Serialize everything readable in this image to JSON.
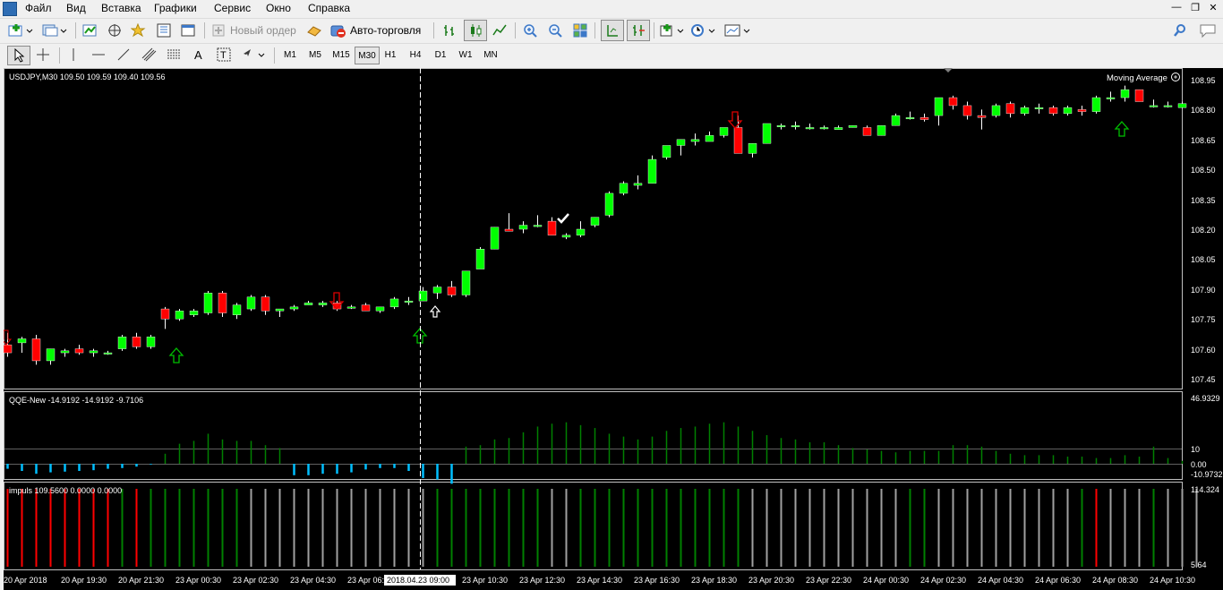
{
  "menu": [
    "Файл",
    "Вид",
    "Вставка",
    "Графики",
    "Сервис",
    "Окно",
    "Справка"
  ],
  "toolbar": {
    "new_order": "Новый ордер",
    "auto_trading": "Авто-торговля"
  },
  "timeframes": [
    "M1",
    "M5",
    "M15",
    "M30",
    "H1",
    "H4",
    "D1",
    "W1",
    "MN"
  ],
  "active_timeframe": "M30",
  "chart": {
    "symbol_info": "USDJPY,M30  109.50 109.59 109.40 109.56",
    "indicator_label": "Moving Average",
    "price_axis": [
      "108.95",
      "108.80",
      "108.65",
      "108.50",
      "108.35",
      "108.20",
      "108.05",
      "107.90",
      "107.75",
      "107.60",
      "107.45"
    ],
    "crosshair_time": "2018.04.23 09:00",
    "time_axis": [
      "20 Apr 2018",
      "20 Apr 19:30",
      "20 Apr 21:30",
      "23 Apr 00:30",
      "23 Apr 02:30",
      "23 Apr 04:30",
      "23 Apr 06:30",
      "23 Apr 08:30",
      "23 Apr 10:30",
      "23 Apr 12:30",
      "23 Apr 14:30",
      "23 Apr 16:30",
      "23 Apr 18:30",
      "23 Apr 20:30",
      "23 Apr 22:30",
      "24 Apr 00:30",
      "24 Apr 02:30",
      "24 Apr 04:30",
      "24 Apr 06:30",
      "24 Apr 08:30",
      "24 Apr 10:30"
    ]
  },
  "qqe": {
    "label": "QQE-New -14.9192 -14.9192 -9.7106",
    "axis": [
      "46.9329",
      "10",
      "0.00",
      "-10.9732"
    ]
  },
  "impuls": {
    "label": "impuls 109.5600 0.0000 0.0000",
    "axis": [
      "114.324",
      "5.64"
    ]
  },
  "colors": {
    "bull": "#00ff00",
    "bear": "#ff0000",
    "qqe_pos": "#008000",
    "qqe_neg": "#00bfff",
    "imp_red": "#ff0000",
    "imp_green": "#008000",
    "imp_gray": "#a0a0a0"
  },
  "chart_data": {
    "type": "candlestick",
    "candles": [
      [
        "O",
        107.62,
        107.68,
        107.56,
        107.58
      ],
      [
        null,
        107.63,
        107.66,
        107.58,
        107.65
      ],
      [
        null,
        107.65,
        107.67,
        107.52,
        107.54
      ],
      [
        null,
        107.54,
        107.6,
        107.52,
        107.6
      ],
      [
        null,
        107.58,
        107.6,
        107.56,
        107.59
      ],
      [
        null,
        107.6,
        107.62,
        107.57,
        107.58
      ],
      [
        null,
        107.58,
        107.6,
        107.56,
        107.59
      ],
      [
        null,
        107.58,
        107.59,
        107.57,
        107.58
      ],
      [
        null,
        107.6,
        107.67,
        107.59,
        107.66
      ],
      [
        null,
        107.66,
        107.68,
        107.6,
        107.61
      ],
      [
        null,
        107.61,
        107.67,
        107.6,
        107.66
      ],
      [
        null,
        107.8,
        107.81,
        107.7,
        107.75
      ],
      [
        null,
        107.75,
        107.8,
        107.74,
        107.79
      ],
      [
        null,
        107.77,
        107.8,
        107.76,
        107.79
      ],
      [
        null,
        107.78,
        107.89,
        107.77,
        107.88
      ],
      [
        null,
        107.88,
        107.89,
        107.76,
        107.78
      ],
      [
        null,
        107.77,
        107.83,
        107.75,
        107.82
      ],
      [
        null,
        107.8,
        107.87,
        107.79,
        107.86
      ],
      [
        null,
        107.86,
        107.87,
        107.77,
        107.79
      ],
      [
        null,
        107.79,
        107.8,
        107.76,
        107.8
      ],
      [
        null,
        107.8,
        107.82,
        107.79,
        107.81
      ],
      [
        null,
        107.82,
        107.84,
        107.82,
        107.83
      ],
      [
        null,
        107.82,
        107.84,
        107.81,
        107.83
      ],
      [
        null,
        107.83,
        107.84,
        107.79,
        107.8
      ],
      [
        null,
        107.81,
        107.82,
        107.8,
        107.81
      ],
      [
        null,
        107.82,
        107.83,
        107.79,
        107.79
      ],
      [
        null,
        107.79,
        107.81,
        107.78,
        107.81
      ],
      [
        null,
        107.81,
        107.86,
        107.8,
        107.85
      ],
      [
        null,
        107.84,
        107.86,
        107.82,
        107.84
      ],
      [
        null,
        107.84,
        107.91,
        107.84,
        107.89
      ],
      [
        null,
        107.88,
        107.92,
        107.85,
        107.91
      ],
      [
        null,
        107.91,
        107.94,
        107.86,
        107.87
      ],
      [
        null,
        107.87,
        107.99,
        107.86,
        107.99
      ],
      [
        null,
        108.0,
        108.11,
        108.0,
        108.1
      ],
      [
        null,
        108.1,
        108.21,
        108.1,
        108.21
      ],
      [
        null,
        108.2,
        108.28,
        108.19,
        108.19
      ],
      [
        null,
        108.2,
        108.24,
        108.18,
        108.22
      ],
      [
        null,
        108.22,
        108.27,
        108.21,
        108.22
      ],
      [
        null,
        108.24,
        108.26,
        108.17,
        108.17
      ],
      [
        null,
        108.16,
        108.18,
        108.15,
        108.17
      ],
      [
        null,
        108.17,
        108.24,
        108.16,
        108.2
      ],
      [
        null,
        108.22,
        108.26,
        108.21,
        108.26
      ],
      [
        null,
        108.27,
        108.39,
        108.26,
        108.38
      ],
      [
        null,
        108.38,
        108.44,
        108.37,
        108.43
      ],
      [
        null,
        108.42,
        108.47,
        108.4,
        108.43
      ],
      [
        null,
        108.43,
        108.57,
        108.43,
        108.55
      ],
      [
        null,
        108.56,
        108.62,
        108.55,
        108.62
      ],
      [
        null,
        108.62,
        108.65,
        108.57,
        108.65
      ],
      [
        null,
        108.64,
        108.68,
        108.62,
        108.65
      ],
      [
        null,
        108.64,
        108.69,
        108.64,
        108.67
      ],
      [
        null,
        108.67,
        108.7,
        108.66,
        108.71
      ],
      [
        null,
        108.71,
        108.77,
        108.61,
        108.58
      ],
      [
        null,
        108.58,
        108.63,
        108.56,
        108.63
      ],
      [
        null,
        108.63,
        108.73,
        108.63,
        108.73
      ],
      [
        null,
        108.72,
        108.73,
        108.7,
        108.72
      ],
      [
        null,
        108.72,
        108.74,
        108.7,
        108.72
      ],
      [
        null,
        108.71,
        108.73,
        108.7,
        108.71
      ],
      [
        null,
        108.71,
        108.72,
        108.7,
        108.71
      ],
      [
        null,
        108.7,
        108.72,
        108.7,
        108.71
      ],
      [
        null,
        108.71,
        108.72,
        108.71,
        108.72
      ],
      [
        null,
        108.71,
        108.72,
        108.67,
        108.67
      ],
      [
        null,
        108.67,
        108.72,
        108.67,
        108.72
      ],
      [
        null,
        108.72,
        108.78,
        108.72,
        108.77
      ],
      [
        null,
        108.76,
        108.79,
        108.75,
        108.76
      ],
      [
        null,
        108.76,
        108.78,
        108.74,
        108.75
      ],
      [
        null,
        108.77,
        108.86,
        108.72,
        108.86
      ],
      [
        null,
        108.86,
        108.87,
        108.8,
        108.82
      ],
      [
        null,
        108.82,
        108.84,
        108.75,
        108.77
      ],
      [
        null,
        108.77,
        108.8,
        108.7,
        108.76
      ],
      [
        null,
        108.77,
        108.83,
        108.76,
        108.82
      ],
      [
        null,
        108.83,
        108.84,
        108.76,
        108.78
      ],
      [
        null,
        108.78,
        108.82,
        108.77,
        108.81
      ],
      [
        null,
        108.81,
        108.83,
        108.78,
        108.81
      ],
      [
        null,
        108.81,
        108.82,
        108.77,
        108.78
      ],
      [
        null,
        108.78,
        108.82,
        108.77,
        108.81
      ],
      [
        null,
        108.8,
        108.82,
        108.77,
        108.79
      ],
      [
        null,
        108.79,
        108.87,
        108.78,
        108.86
      ],
      [
        null,
        108.86,
        108.89,
        108.84,
        108.86
      ],
      [
        null,
        108.86,
        108.92,
        108.84,
        108.9
      ],
      [
        null,
        108.9,
        108.9,
        108.84,
        108.84
      ],
      [
        null,
        108.82,
        108.85,
        108.81,
        108.82
      ],
      [
        null,
        108.82,
        108.84,
        108.81,
        108.82
      ],
      [
        null,
        108.81,
        108.84,
        108.81,
        108.83
      ]
    ],
    "qqe": [
      -3.5,
      -5,
      -7,
      -6,
      -5.5,
      -5,
      -4.5,
      -3.5,
      -3,
      -2,
      -0.5,
      7,
      14,
      16,
      21,
      17,
      16,
      16,
      13,
      11,
      -8,
      -8,
      -7,
      -7,
      -6,
      -4,
      -3,
      -3,
      -5,
      -10,
      -11,
      -14,
      12,
      13,
      17,
      18,
      22,
      26,
      28,
      29,
      27,
      25,
      21,
      19,
      17,
      19,
      23,
      25,
      26,
      28,
      29,
      26,
      23,
      20,
      18,
      17,
      15,
      15,
      13,
      11,
      10,
      9,
      8,
      9,
      9,
      9,
      13,
      13,
      12,
      9,
      7,
      6,
      6,
      6,
      5,
      5,
      4,
      4,
      6,
      5,
      12,
      4,
      2
    ],
    "impuls": [
      "red",
      "red",
      "red",
      "red",
      "red",
      "red",
      "red",
      "red",
      "green",
      "red",
      "green",
      "green",
      "green",
      "green",
      "green",
      "green",
      "green",
      "gray",
      "gray",
      "gray",
      "gray",
      "gray",
      "gray",
      "gray",
      "gray",
      "gray",
      "gray",
      "gray",
      "gray",
      "gray",
      "green",
      "green",
      "green",
      "green",
      "green",
      "green",
      "green",
      "green",
      "gray",
      "gray",
      "green",
      "green",
      "green",
      "green",
      "green",
      "green",
      "green",
      "green",
      "green",
      "green",
      "green",
      "green",
      "gray",
      "gray",
      "gray",
      "gray",
      "gray",
      "gray",
      "gray",
      "gray",
      "gray",
      "gray",
      "gray",
      "green",
      "green",
      "gray",
      "gray",
      "gray",
      "gray",
      "gray",
      "gray",
      "gray",
      "gray",
      "gray",
      "gray",
      "green",
      "red",
      "gray",
      "gray",
      "gray",
      "green",
      "gray",
      "gray",
      "gray"
    ]
  }
}
